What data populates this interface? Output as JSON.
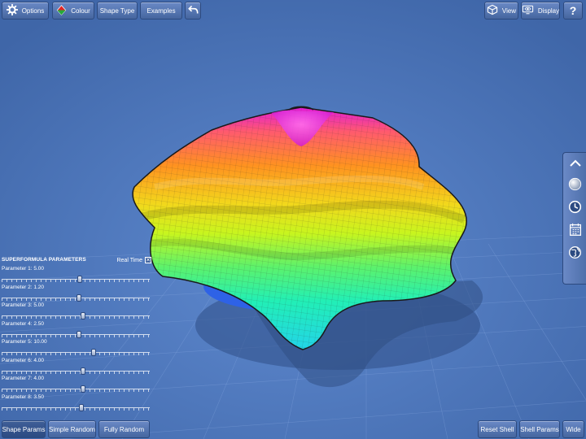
{
  "toolbar": {
    "options_label": "Options",
    "colour_label": "Colour",
    "shape_type_label": "Shape Type",
    "examples_label": "Examples",
    "view_label": "View",
    "display_label": "Display",
    "help_glyph": "?"
  },
  "params_panel": {
    "title": "SUPERFORMULA PARAMETERS",
    "real_time_label": "Real Time",
    "real_time_checked": true,
    "slider_min": 0,
    "slider_max": 40,
    "params": [
      {
        "label": "Parameter 1: 5.00",
        "level": 0.53
      },
      {
        "label": "Parameter 2: 1.20",
        "level": 0.52
      },
      {
        "label": "Parameter 3: 5.00",
        "level": 0.55
      },
      {
        "label": "Parameter 4: 2.50",
        "level": 0.52
      },
      {
        "label": "Parameter 5: 10.00",
        "level": 0.62
      },
      {
        "label": "Parameter 6: 4.00",
        "level": 0.55
      },
      {
        "label": "Parameter 7: 4.00",
        "level": 0.55
      },
      {
        "label": "Parameter 8: 3.50",
        "level": 0.54
      }
    ]
  },
  "bottom_bar": {
    "shape_params_label": "Shape Params",
    "simple_random_label": "Simple Random",
    "fully_random_label": "Fully Random",
    "reset_shell_label": "Reset Shell",
    "shell_params_label": "Shell Params",
    "wide_label": "Wide"
  },
  "side_panel": {
    "icons": [
      "chevron-up-icon",
      "sphere-icon",
      "clock-icon",
      "calendar-icon",
      "globe-icon"
    ]
  },
  "colors": {
    "background": "#4f79bf",
    "grid_line": "#8fb0e6",
    "button": "#5677b3",
    "button_border": "#2d4a7f",
    "shape_top": "#e21bd8",
    "shape_upper": "#ff8a1f",
    "shape_middle": "#d8f21a",
    "shape_lower": "#22f0b2",
    "shape_bottom": "#2f6ff0"
  }
}
